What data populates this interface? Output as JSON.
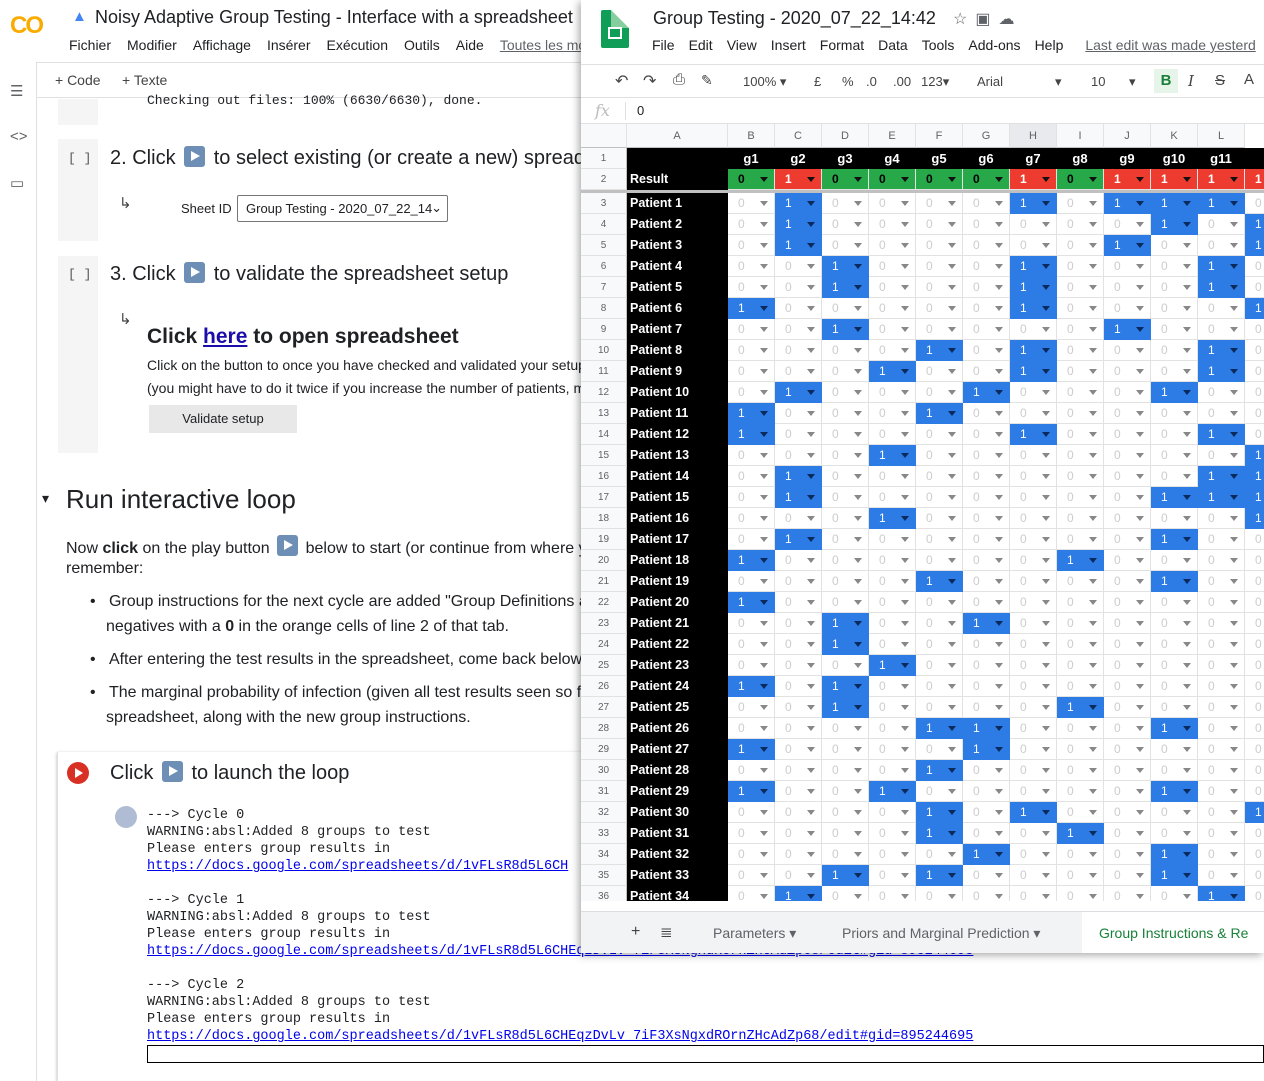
{
  "colab": {
    "logo": "CO",
    "title": "Noisy Adaptive Group Testing - Interface with a spreadsheet",
    "menu": [
      "Fichier",
      "Modifier",
      "Affichage",
      "Insérer",
      "Exécution",
      "Outils",
      "Aide"
    ],
    "menu_link": "Toutes les mod",
    "toolbar": {
      "code": "+ Code",
      "text": "+ Texte"
    },
    "cell1_out": "Checking out files: 100% (6630/6630), done.",
    "step2": {
      "prefix": "2. Click",
      "suffix": "to select existing (or create a new) spread",
      "sheet_label": "Sheet ID",
      "sheet_value": "Group Testing - 2020_07_22_14"
    },
    "step3": {
      "prefix": "3. Click",
      "suffix": "to validate the spreadsheet setup",
      "open_pre": "Click",
      "open_link": "here",
      "open_post": "to open spreadsheet",
      "desc1": "Click on the button to once you have checked and validated your setup",
      "desc2": "(you might have to do it twice if you increase the number of patients, m",
      "button": "Validate setup"
    },
    "section": {
      "title": "Run interactive loop",
      "intro_a": "Now ",
      "intro_b": "click",
      "intro_c": " on the play button",
      "intro_d": " below to start (or continue from where y",
      "intro_e": "remember:",
      "bullets": [
        {
          "l1": "Group instructions for the next cycle are added \"Group Definitions a",
          "l2a": "negatives with a ",
          "l2b": "0",
          "l2c": " in the orange cells of line 2 of that tab."
        },
        {
          "l1": "After entering the test results in the spreadsheet, come back below"
        },
        {
          "l1": "The marginal probability of infection (given all test results seen so f",
          "l2a": "spreadsheet, along with the new group instructions."
        }
      ]
    },
    "loop": {
      "prefix": "Click",
      "suffix": "to launch the loop"
    },
    "output": [
      {
        "c": "---> Cycle 0",
        "w": "WARNING:absl:Added 8 groups to test",
        "p": "Please enters group results in",
        "u": "https://docs.google.com/spreadsheets/d/1vFLsR8d5L6CH"
      },
      {
        "c": "---> Cycle 1",
        "w": "WARNING:absl:Added 8 groups to test",
        "p": "Please enters group results in",
        "u": "https://docs.google.com/spreadsheets/d/1vFLsR8d5L6CHEqzDvLv_7iF3XsNgxdROrnZHcAdZp68/edit#gid=895244695"
      },
      {
        "c": "---> Cycle 2",
        "w": "WARNING:absl:Added 8 groups to test",
        "p": "Please enters group results in",
        "u": "https://docs.google.com/spreadsheets/d/1vFLsR8d5L6CHEqzDvLv_7iF3XsNgxdROrnZHcAdZp68/edit#gid=895244695"
      }
    ]
  },
  "sheets": {
    "title": "Group Testing - 2020_07_22_14:42",
    "menu": [
      "File",
      "Edit",
      "View",
      "Insert",
      "Format",
      "Data",
      "Tools",
      "Add-ons",
      "Help"
    ],
    "last_edit": "Last edit was made yesterd",
    "toolbar": {
      "zoom": "100%",
      "currency": "£",
      "percent": "%",
      "dec1": ".0",
      "dec2": ".00",
      "fmt": "123",
      "font": "Arial",
      "size": "10",
      "bold": "B",
      "italic": "I",
      "strike": "S",
      "textcolor": "A"
    },
    "formula": "0",
    "columns": [
      "A",
      "B",
      "C",
      "D",
      "E",
      "F",
      "G",
      "H",
      "I",
      "J",
      "K",
      "L"
    ],
    "groups": [
      "g1",
      "g2",
      "g3",
      "g4",
      "g5",
      "g6",
      "g7",
      "g8",
      "g9",
      "g10",
      "g11",
      "g"
    ],
    "result_label": "Result",
    "results": [
      0,
      1,
      0,
      0,
      0,
      0,
      1,
      0,
      1,
      1,
      1,
      1
    ],
    "patients": [
      "Patient 1",
      "Patient 2",
      "Patient 3",
      "Patient 4",
      "Patient 5",
      "Patient 6",
      "Patient 7",
      "Patient 8",
      "Patient 9",
      "Patient 10",
      "Patient 11",
      "Patient 12",
      "Patient 13",
      "Patient 14",
      "Patient 15",
      "Patient 16",
      "Patient 17",
      "Patient 18",
      "Patient 19",
      "Patient 20",
      "Patient 21",
      "Patient 22",
      "Patient 23",
      "Patient 24",
      "Patient 25",
      "Patient 26",
      "Patient 27",
      "Patient 28",
      "Patient 29",
      "Patient 30",
      "Patient 31",
      "Patient 32",
      "Patient 33",
      "Patient 34"
    ],
    "matrix": [
      [
        0,
        1,
        0,
        0,
        0,
        0,
        1,
        0,
        1,
        1,
        1,
        0
      ],
      [
        0,
        1,
        0,
        0,
        0,
        0,
        0,
        0,
        0,
        1,
        0,
        1
      ],
      [
        0,
        1,
        0,
        0,
        0,
        0,
        0,
        0,
        1,
        0,
        0,
        1
      ],
      [
        0,
        0,
        1,
        0,
        0,
        0,
        1,
        0,
        0,
        0,
        1,
        0
      ],
      [
        0,
        0,
        1,
        0,
        0,
        0,
        1,
        0,
        0,
        0,
        1,
        0
      ],
      [
        1,
        0,
        0,
        0,
        0,
        0,
        1,
        0,
        0,
        0,
        0,
        1
      ],
      [
        0,
        0,
        1,
        0,
        0,
        0,
        0,
        0,
        1,
        0,
        0,
        0
      ],
      [
        0,
        0,
        0,
        0,
        1,
        0,
        1,
        0,
        0,
        0,
        1,
        0
      ],
      [
        0,
        0,
        0,
        1,
        0,
        0,
        1,
        0,
        0,
        0,
        1,
        0
      ],
      [
        0,
        1,
        0,
        0,
        0,
        1,
        0,
        0,
        0,
        1,
        0,
        0
      ],
      [
        1,
        0,
        0,
        0,
        1,
        0,
        0,
        0,
        0,
        0,
        0,
        0
      ],
      [
        1,
        0,
        0,
        0,
        0,
        0,
        1,
        0,
        0,
        0,
        1,
        0
      ],
      [
        0,
        0,
        0,
        1,
        0,
        0,
        0,
        0,
        0,
        0,
        0,
        1
      ],
      [
        0,
        1,
        0,
        0,
        0,
        0,
        0,
        0,
        0,
        0,
        1,
        1
      ],
      [
        0,
        1,
        0,
        0,
        0,
        0,
        0,
        0,
        0,
        1,
        1,
        1
      ],
      [
        0,
        0,
        0,
        1,
        0,
        0,
        0,
        0,
        0,
        0,
        0,
        1
      ],
      [
        0,
        1,
        0,
        0,
        0,
        0,
        0,
        0,
        0,
        1,
        0,
        0
      ],
      [
        1,
        0,
        0,
        0,
        0,
        0,
        0,
        1,
        0,
        0,
        0,
        0
      ],
      [
        0,
        0,
        0,
        0,
        1,
        0,
        0,
        0,
        0,
        1,
        0,
        0
      ],
      [
        1,
        0,
        0,
        0,
        0,
        0,
        0,
        0,
        0,
        0,
        0,
        0
      ],
      [
        0,
        0,
        1,
        0,
        0,
        1,
        0,
        0,
        0,
        0,
        0,
        0
      ],
      [
        0,
        0,
        1,
        0,
        0,
        0,
        0,
        0,
        0,
        0,
        0,
        0
      ],
      [
        0,
        0,
        0,
        1,
        0,
        0,
        0,
        0,
        0,
        0,
        0,
        0
      ],
      [
        1,
        0,
        1,
        0,
        0,
        0,
        0,
        0,
        0,
        0,
        0,
        0
      ],
      [
        0,
        0,
        1,
        0,
        0,
        0,
        0,
        1,
        0,
        0,
        0,
        0
      ],
      [
        0,
        0,
        0,
        0,
        1,
        1,
        0,
        0,
        0,
        1,
        0,
        0
      ],
      [
        1,
        0,
        0,
        0,
        0,
        1,
        0,
        0,
        0,
        0,
        0,
        0
      ],
      [
        0,
        0,
        0,
        0,
        1,
        0,
        0,
        0,
        0,
        0,
        0,
        0
      ],
      [
        1,
        0,
        0,
        1,
        0,
        0,
        0,
        0,
        0,
        1,
        0,
        0
      ],
      [
        0,
        0,
        0,
        0,
        1,
        0,
        1,
        0,
        0,
        0,
        0,
        1
      ],
      [
        0,
        0,
        0,
        0,
        1,
        0,
        0,
        1,
        0,
        0,
        0,
        0
      ],
      [
        0,
        0,
        0,
        0,
        0,
        1,
        0,
        0,
        0,
        1,
        0,
        0
      ],
      [
        0,
        0,
        1,
        0,
        1,
        0,
        0,
        0,
        0,
        1,
        0,
        0
      ],
      [
        0,
        1,
        0,
        0,
        0,
        0,
        0,
        0,
        0,
        0,
        1,
        0
      ]
    ],
    "tabs": [
      "Parameters",
      "Priors and Marginal Prediction",
      "Group Instructions & Re"
    ]
  }
}
